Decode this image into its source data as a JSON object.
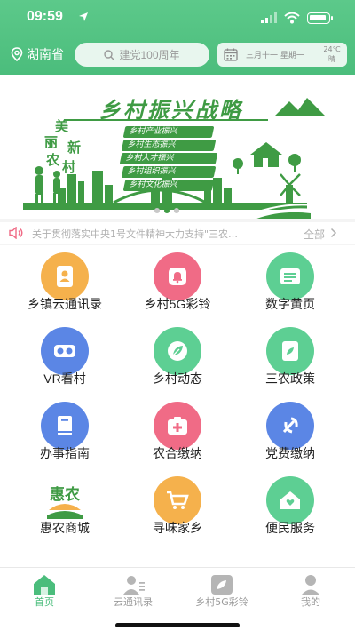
{
  "status_bar": {
    "time": "09:59"
  },
  "header": {
    "province": "湖南省",
    "search_placeholder": "建党100周年",
    "calendar": {
      "date": "三月十一  星期一",
      "temperature": "24℃",
      "weather": "晴"
    }
  },
  "banner": {
    "title": "乡村振兴战略",
    "slogan": [
      "美",
      "丽",
      "新",
      "农",
      "村"
    ],
    "items": [
      "乡村产业振兴",
      "乡村生态振兴",
      "乡村人才振兴",
      "乡村组织振兴",
      "乡村文化振兴"
    ],
    "pages": 3,
    "active_page": 1
  },
  "notice": {
    "text": "关于贯彻落实中央1号文件精神大力支持\"三农…",
    "more_label": "全部"
  },
  "services": [
    {
      "label": "乡镇云通讯录",
      "icon": "contacts-book-icon",
      "color": "#f5b14c"
    },
    {
      "label": "乡村5G彩铃",
      "icon": "bell-icon",
      "color": "#f06b86"
    },
    {
      "label": "数字黄页",
      "icon": "yellow-pages-icon",
      "color": "#5dcf93"
    },
    {
      "label": "VR看村",
      "icon": "vr-goggles-icon",
      "color": "#5b86e5"
    },
    {
      "label": "乡村动态",
      "icon": "leaf-icon",
      "color": "#5dcf93"
    },
    {
      "label": "三农政策",
      "icon": "policy-document-icon",
      "color": "#5dcf93"
    },
    {
      "label": "办事指南",
      "icon": "guide-book-icon",
      "color": "#5b86e5"
    },
    {
      "label": "农合缴纳",
      "icon": "medical-kit-icon",
      "color": "#f06b86"
    },
    {
      "label": "党费缴纳",
      "icon": "party-emblem-icon",
      "color": "#5b86e5"
    },
    {
      "label": "惠农商城",
      "icon": "huinong-logo-icon",
      "color": "#ffffff",
      "logo_text": "惠农"
    },
    {
      "label": "寻味家乡",
      "icon": "shopping-cart-icon",
      "color": "#f5b14c"
    },
    {
      "label": "便民服务",
      "icon": "home-heart-icon",
      "color": "#5dcf93"
    }
  ],
  "tabs": [
    {
      "label": "首页",
      "icon": "home-icon",
      "active": true
    },
    {
      "label": "云通讯录",
      "icon": "contacts-icon",
      "active": false
    },
    {
      "label": "乡村5G彩铃",
      "icon": "ringtone-icon",
      "active": false
    },
    {
      "label": "我的",
      "icon": "profile-icon",
      "active": false
    }
  ],
  "colors": {
    "primary": "#4bbd7c",
    "banner_green": "#3f9b44"
  }
}
